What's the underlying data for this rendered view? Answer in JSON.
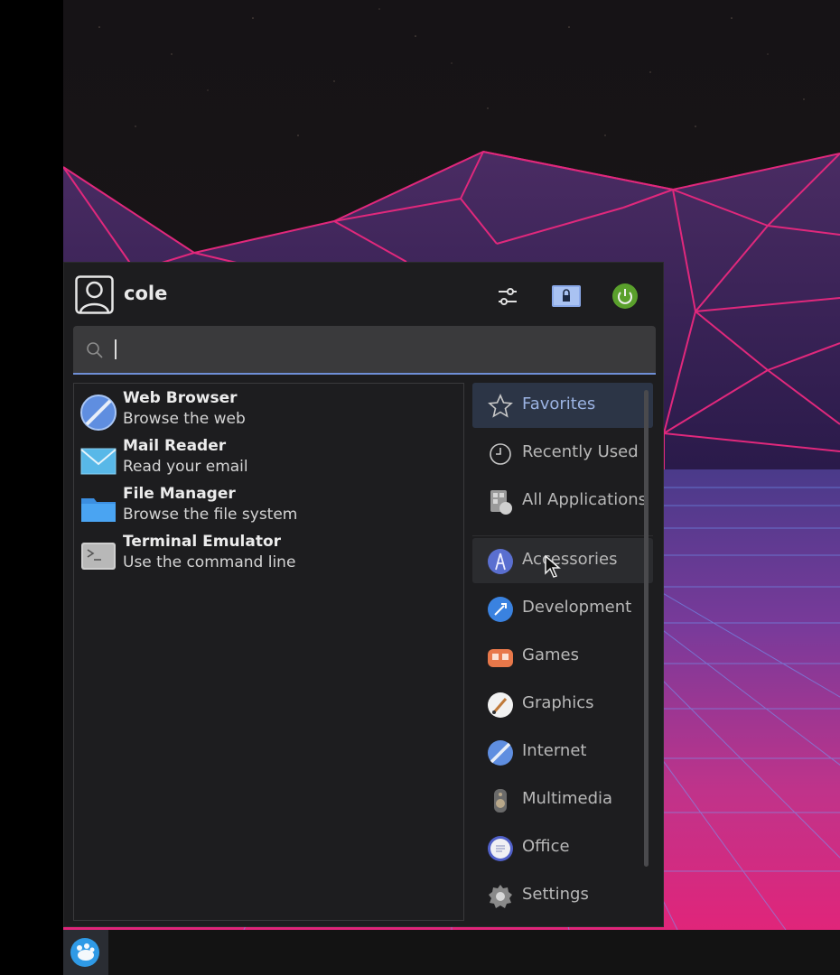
{
  "user": {
    "name": "cole"
  },
  "header": {
    "settings_icon": "sliders-icon",
    "lock_icon": "lock-screen-icon",
    "logout_icon": "logout-icon"
  },
  "search": {
    "placeholder": "",
    "value": ""
  },
  "favorites": [
    {
      "name": "Web Browser",
      "description": "Browse the web",
      "icon": "web-browser-icon"
    },
    {
      "name": "Mail Reader",
      "description": "Read your email",
      "icon": "mail-icon"
    },
    {
      "name": "File Manager",
      "description": "Browse the file system",
      "icon": "folder-icon"
    },
    {
      "name": "Terminal Emulator",
      "description": "Use the command line",
      "icon": "terminal-icon"
    }
  ],
  "categories": [
    {
      "label": "Favorites",
      "icon": "star-icon",
      "state": "selected"
    },
    {
      "label": "Recently Used",
      "icon": "clock-icon"
    },
    {
      "label": "All Applications",
      "icon": "all-apps-icon"
    },
    {
      "label": "Accessories",
      "icon": "accessories-icon",
      "state": "hover"
    },
    {
      "label": "Development",
      "icon": "development-icon"
    },
    {
      "label": "Games",
      "icon": "games-icon"
    },
    {
      "label": "Graphics",
      "icon": "graphics-icon"
    },
    {
      "label": "Internet",
      "icon": "internet-icon"
    },
    {
      "label": "Multimedia",
      "icon": "multimedia-icon"
    },
    {
      "label": "Office",
      "icon": "office-icon"
    },
    {
      "label": "Settings",
      "icon": "settings-gear-icon"
    }
  ],
  "colors": {
    "accent": "#6f8fd6",
    "selected_bg": "#2c3546",
    "menu_bg": "#1d1d1f",
    "wallpaper_lines": "#e0287c"
  },
  "taskbar": {
    "menu_button_icon": "xfce-mouse-icon"
  }
}
